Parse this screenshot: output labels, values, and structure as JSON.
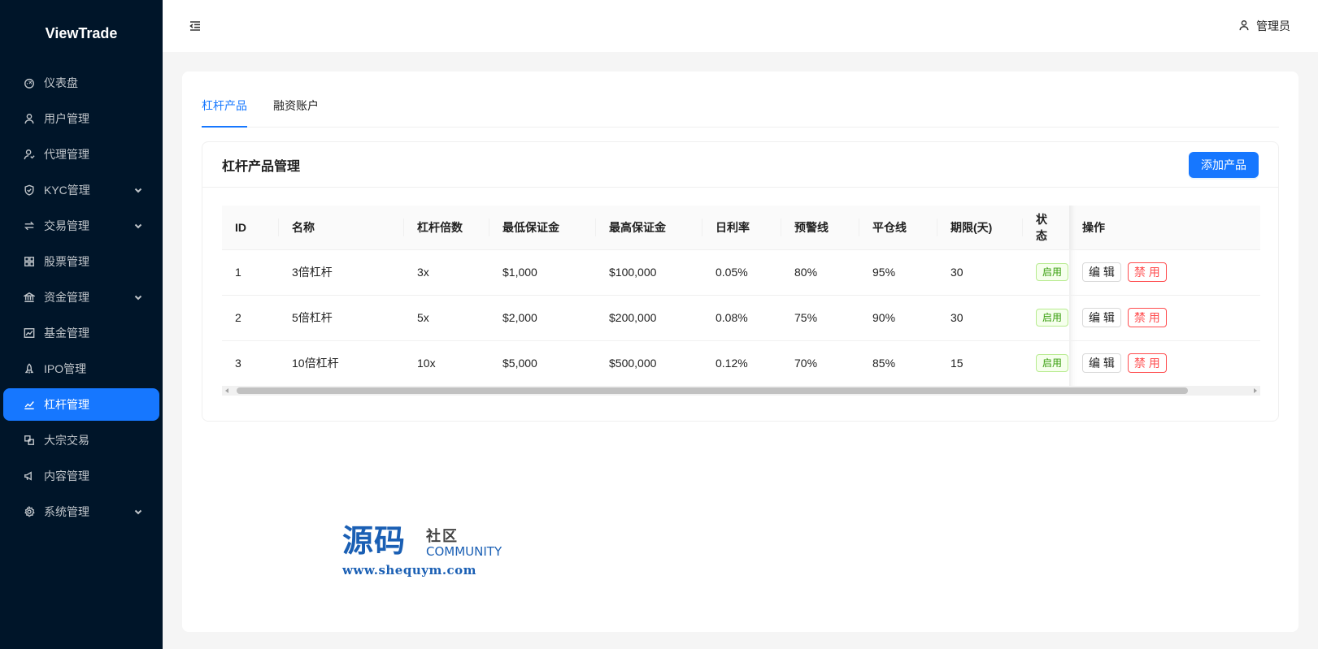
{
  "app": {
    "logo": "ViewTrade"
  },
  "sidebar": {
    "items": [
      {
        "label": "仪表盘",
        "icon": "dashboard-icon",
        "has_children": false,
        "active": false
      },
      {
        "label": "用户管理",
        "icon": "user-icon",
        "has_children": false,
        "active": false
      },
      {
        "label": "代理管理",
        "icon": "agent-icon",
        "has_children": false,
        "active": false
      },
      {
        "label": "KYC管理",
        "icon": "shield-check-icon",
        "has_children": true,
        "active": false
      },
      {
        "label": "交易管理",
        "icon": "swap-icon",
        "has_children": true,
        "active": false
      },
      {
        "label": "股票管理",
        "icon": "grid-icon",
        "has_children": false,
        "active": false
      },
      {
        "label": "资金管理",
        "icon": "bank-icon",
        "has_children": true,
        "active": false
      },
      {
        "label": "基金管理",
        "icon": "fund-chart-icon",
        "has_children": false,
        "active": false
      },
      {
        "label": "IPO管理",
        "icon": "rocket-icon",
        "has_children": false,
        "active": false
      },
      {
        "label": "杠杆管理",
        "icon": "line-chart-icon",
        "has_children": false,
        "active": true
      },
      {
        "label": "大宗交易",
        "icon": "block-icon",
        "has_children": false,
        "active": false
      },
      {
        "label": "内容管理",
        "icon": "notification-icon",
        "has_children": false,
        "active": false
      },
      {
        "label": "系统管理",
        "icon": "settings-icon",
        "has_children": true,
        "active": false
      }
    ]
  },
  "header": {
    "user_label": "管理员"
  },
  "tabs": [
    {
      "label": "杠杆产品",
      "active": true
    },
    {
      "label": "融资账户",
      "active": false
    }
  ],
  "card": {
    "title": "杠杆产品管理",
    "add_button": "添加产品"
  },
  "table": {
    "columns": [
      "ID",
      "名称",
      "杠杆倍数",
      "最低保证金",
      "最高保证金",
      "日利率",
      "预警线",
      "平仓线",
      "期限(天)",
      "状态",
      "操作"
    ],
    "rows": [
      {
        "id": "1",
        "name": "3倍杠杆",
        "leverage": "3x",
        "min_margin": "$1,000",
        "max_margin": "$100,000",
        "daily_rate": "0.05%",
        "warning": "80%",
        "liquidation": "95%",
        "term": "30",
        "status": "启用"
      },
      {
        "id": "2",
        "name": "5倍杠杆",
        "leverage": "5x",
        "min_margin": "$2,000",
        "max_margin": "$200,000",
        "daily_rate": "0.08%",
        "warning": "75%",
        "liquidation": "90%",
        "term": "30",
        "status": "启用"
      },
      {
        "id": "3",
        "name": "10倍杠杆",
        "leverage": "10x",
        "min_margin": "$5,000",
        "max_margin": "$500,000",
        "daily_rate": "0.12%",
        "warning": "70%",
        "liquidation": "85%",
        "term": "15",
        "status": "启用"
      }
    ],
    "actions": {
      "edit": "编 辑",
      "disable": "禁 用"
    }
  },
  "watermark": {
    "big": "源码",
    "small_cn": "社区",
    "community": "COMMUNITY",
    "url": "www.shequym.com"
  },
  "colors": {
    "sidebar_bg": "#001529",
    "primary": "#1677ff",
    "danger": "#ff4d4f",
    "success": "#389e0d"
  }
}
